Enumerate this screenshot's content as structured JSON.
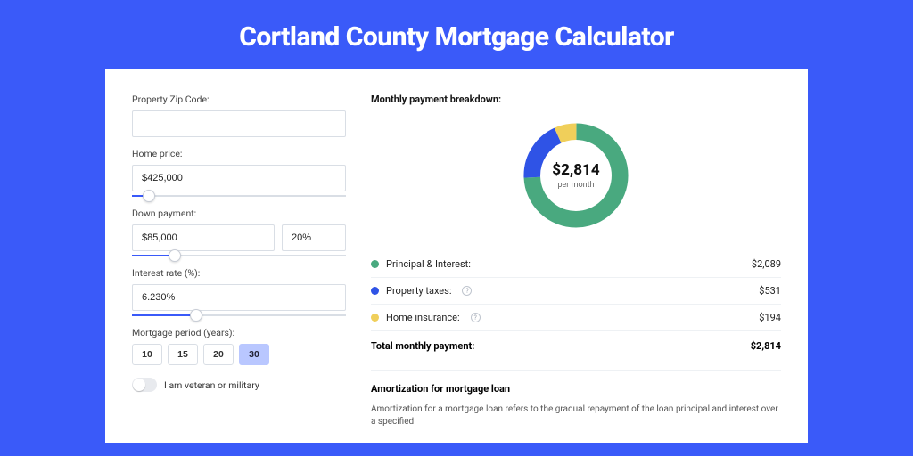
{
  "header": {
    "title": "Cortland County Mortgage Calculator"
  },
  "form": {
    "zip_label": "Property Zip Code:",
    "zip_value": "",
    "home_price_label": "Home price:",
    "home_price_value": "$425,000",
    "down_payment_label": "Down payment:",
    "down_payment_value": "$85,000",
    "down_payment_pct": "20%",
    "interest_label": "Interest rate (%):",
    "interest_value": "6.230%",
    "period_label": "Mortgage period (years):",
    "periods": [
      "10",
      "15",
      "20",
      "30"
    ],
    "period_active": "30",
    "veteran_label": "I am veteran or military"
  },
  "breakdown": {
    "title": "Monthly payment breakdown:",
    "center_value": "$2,814",
    "center_sub": "per month",
    "items": [
      {
        "label": "Principal & Interest:",
        "value": "$2,089",
        "color": "#49a97f",
        "info": false
      },
      {
        "label": "Property taxes:",
        "value": "$531",
        "color": "#2f53e6",
        "info": true
      },
      {
        "label": "Home insurance:",
        "value": "$194",
        "color": "#f0cf5a",
        "info": true
      }
    ],
    "total_label": "Total monthly payment:",
    "total_value": "$2,814"
  },
  "amort": {
    "title": "Amortization for mortgage loan",
    "text": "Amortization for a mortgage loan refers to the gradual repayment of the loan principal and interest over a specified"
  },
  "chart_data": {
    "type": "pie",
    "title": "Monthly payment breakdown",
    "categories": [
      "Principal & Interest",
      "Property taxes",
      "Home insurance"
    ],
    "values": [
      2089,
      531,
      194
    ],
    "colors": [
      "#49a97f",
      "#2f53e6",
      "#f0cf5a"
    ],
    "total": 2814,
    "unit": "USD/month"
  }
}
